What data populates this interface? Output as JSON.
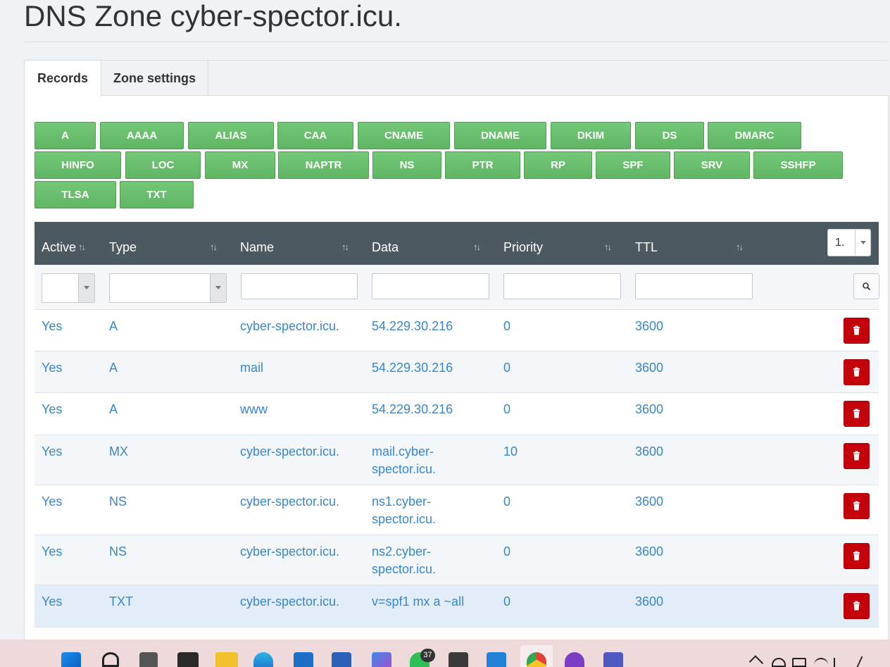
{
  "page": {
    "title": "DNS Zone cyber-spector.icu."
  },
  "tabs": [
    {
      "label": "Records",
      "active": true
    },
    {
      "label": "Zone settings",
      "active": false
    }
  ],
  "record_type_buttons": [
    "A",
    "AAAA",
    "ALIAS",
    "CAA",
    "CNAME",
    "DNAME",
    "DKIM",
    "DS",
    "DMARC",
    "HINFO",
    "LOC",
    "MX",
    "NAPTR",
    "NS",
    "PTR",
    "RP",
    "SPF",
    "SRV",
    "SSHFP",
    "TLSA",
    "TXT"
  ],
  "table": {
    "columns": [
      "Active",
      "Type",
      "Name",
      "Data",
      "Priority",
      "TTL"
    ],
    "page_size": "1.",
    "rows": [
      {
        "active": "Yes",
        "type": "A",
        "name": "cyber-spector.icu.",
        "data": "54.229.30.216",
        "priority": "0",
        "ttl": "3600"
      },
      {
        "active": "Yes",
        "type": "A",
        "name": "mail",
        "data": "54.229.30.216",
        "priority": "0",
        "ttl": "3600"
      },
      {
        "active": "Yes",
        "type": "A",
        "name": "www",
        "data": "54.229.30.216",
        "priority": "0",
        "ttl": "3600"
      },
      {
        "active": "Yes",
        "type": "MX",
        "name": "cyber-spector.icu.",
        "data": "mail.cyber-\nspector.icu.",
        "priority": "10",
        "ttl": "3600"
      },
      {
        "active": "Yes",
        "type": "NS",
        "name": "cyber-spector.icu.",
        "data": "ns1.cyber-\nspector.icu.",
        "priority": "0",
        "ttl": "3600"
      },
      {
        "active": "Yes",
        "type": "NS",
        "name": "cyber-spector.icu.",
        "data": "ns2.cyber-\nspector.icu.",
        "priority": "0",
        "ttl": "3600"
      },
      {
        "active": "Yes",
        "type": "TXT",
        "name": "cyber-spector.icu.",
        "data": "v=spf1 mx a ~all",
        "priority": "0",
        "ttl": "3600"
      }
    ]
  },
  "taskbar": {
    "whatsapp_badge": "37"
  },
  "colors": {
    "accent_green": "#5fb663",
    "header_dark": "#4d5961",
    "link_blue": "#3a86c8",
    "delete_red": "#c4000b"
  }
}
